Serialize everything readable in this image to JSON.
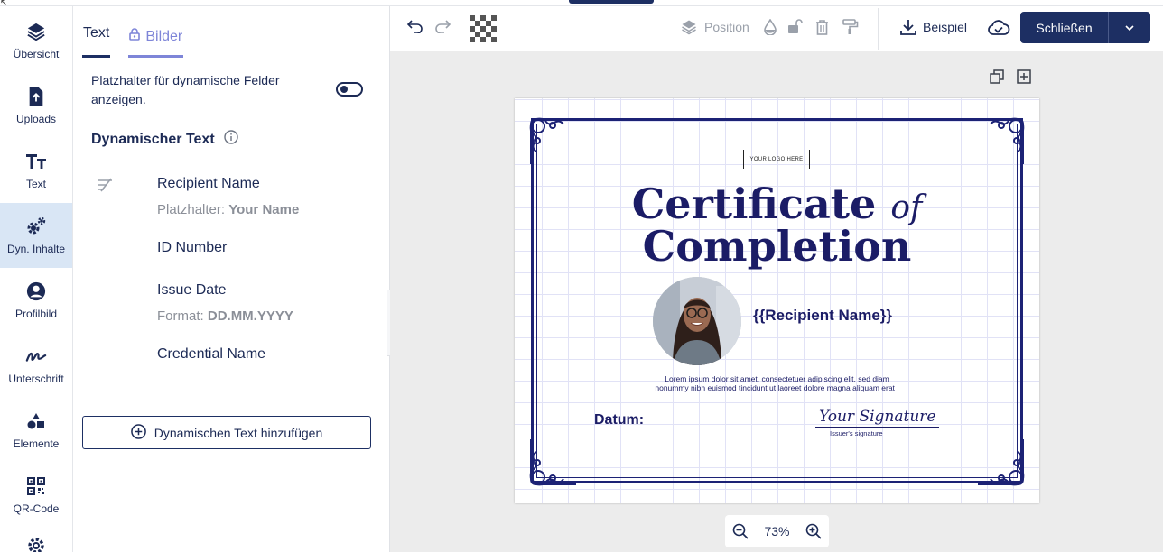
{
  "rail": {
    "items": [
      {
        "label": "Übersicht"
      },
      {
        "label": "Uploads"
      },
      {
        "label": "Text"
      },
      {
        "label": "Dyn. Inhalte"
      },
      {
        "label": "Profilbild"
      },
      {
        "label": "Unterschrift"
      },
      {
        "label": "Elemente"
      },
      {
        "label": "QR-Code"
      }
    ]
  },
  "panel": {
    "tabs": [
      {
        "label": "Text"
      },
      {
        "label": "Bilder"
      }
    ],
    "toggle_label": "Platzhalter für dynamische Felder anzeigen.",
    "section_title": "Dynamischer Text",
    "fields": [
      {
        "name": "Recipient Name",
        "sub_prefix": "Platzhalter:",
        "sub_value": "Your Name"
      },
      {
        "name": "ID Number"
      },
      {
        "name": "Issue Date",
        "sub_prefix": "Format:",
        "sub_value": "DD.MM.YYYY"
      },
      {
        "name": "Credential Name"
      }
    ],
    "add_button": "Dynamischen Text hinzufügen"
  },
  "toolbar": {
    "position_label": "Position",
    "example_label": "Beispiel",
    "close_label": "Schließen"
  },
  "certificate": {
    "logo_text": "YOUR LOGO HERE",
    "title_main": "Certificate",
    "title_of": "of",
    "title_line2": "Completion",
    "recipient_placeholder": "{{Recipient Name}}",
    "lorem_line1": "Lorem ipsum dolor sit amet, consectetuer adipiscing elit, sed diam",
    "lorem_line2": "nonummy nibh euismod tincidunt ut laoreet dolore magna aliquam erat .",
    "date_label": "Datum:",
    "signature": "Your Signature",
    "signature_label": "Issuer's signature"
  },
  "zoom": {
    "level": "73%"
  },
  "colors": {
    "brand": "#1d2f63",
    "accent": "#7e85d8",
    "certificate_ink": "#1b1c66",
    "active_rail": "#d9e6f5"
  }
}
